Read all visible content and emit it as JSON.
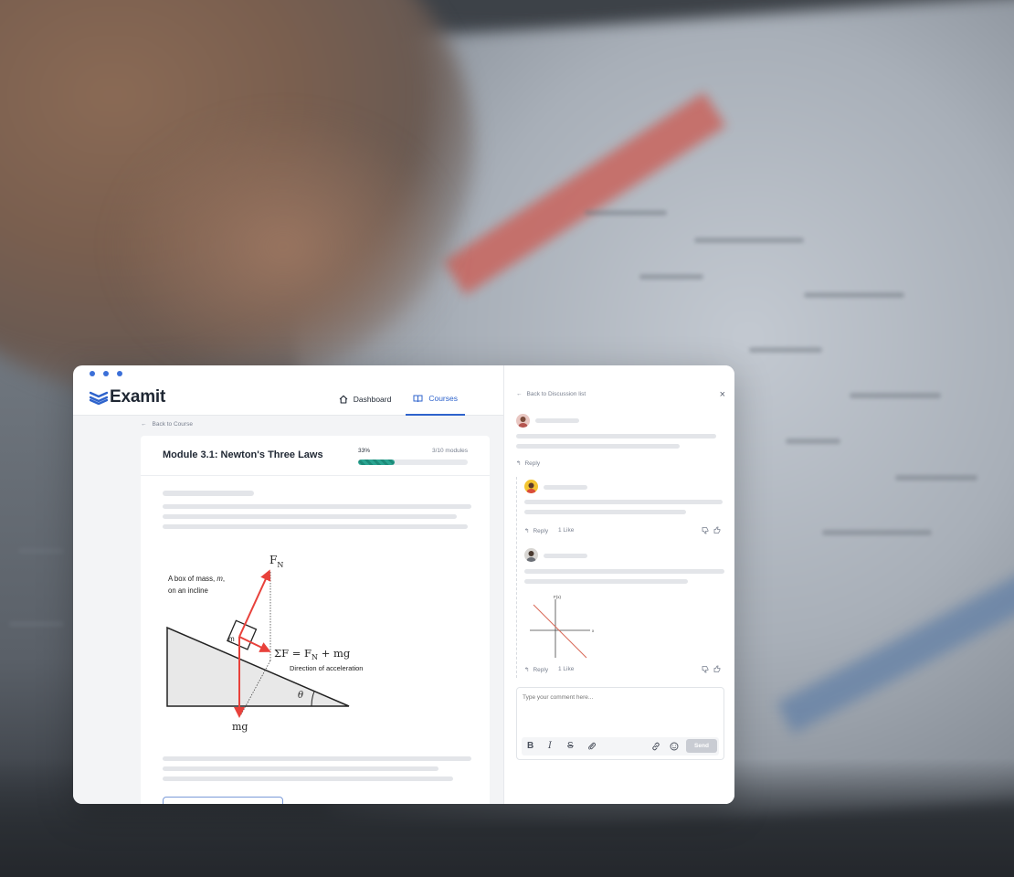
{
  "brand": {
    "name": "Examit"
  },
  "nav": {
    "dashboard": "Dashboard",
    "courses": "Courses"
  },
  "back_to_course": "Back to Course",
  "module": {
    "title": "Module 3.1: Newton's Three Laws",
    "progress_percent": 33,
    "progress_label": "33%",
    "modules_label": "3/10 modules"
  },
  "diagram": {
    "box_caption_line1": "A box of mass, ",
    "box_caption_mass": "m",
    "box_caption_comma": ",",
    "box_caption_line2": "on an incline",
    "box_label": "m",
    "normal_force": "F",
    "normal_force_sub": "N",
    "equation_prefix": "ΣF = F",
    "equation_sub": "N",
    "equation_suffix": " + mg",
    "accel_label": "Direction of acceleration",
    "angle_label": "θ",
    "weight_label": "mg"
  },
  "discussion": {
    "back_label": "Back to Discussion list",
    "close_icon": "×",
    "reply_label": "Reply",
    "likes_label": "1 Like",
    "mini_graph_ylabel": "F(x)",
    "mini_graph_xlabel": "x",
    "comment_placeholder": "Type your comment here...",
    "send_label": "Send",
    "toolbar": {
      "bold": "B",
      "italic": "I",
      "strike": "S"
    }
  },
  "colors": {
    "accent": "#2e63cc",
    "progress": "#2aa592",
    "force_arrows": "#e8413b"
  }
}
